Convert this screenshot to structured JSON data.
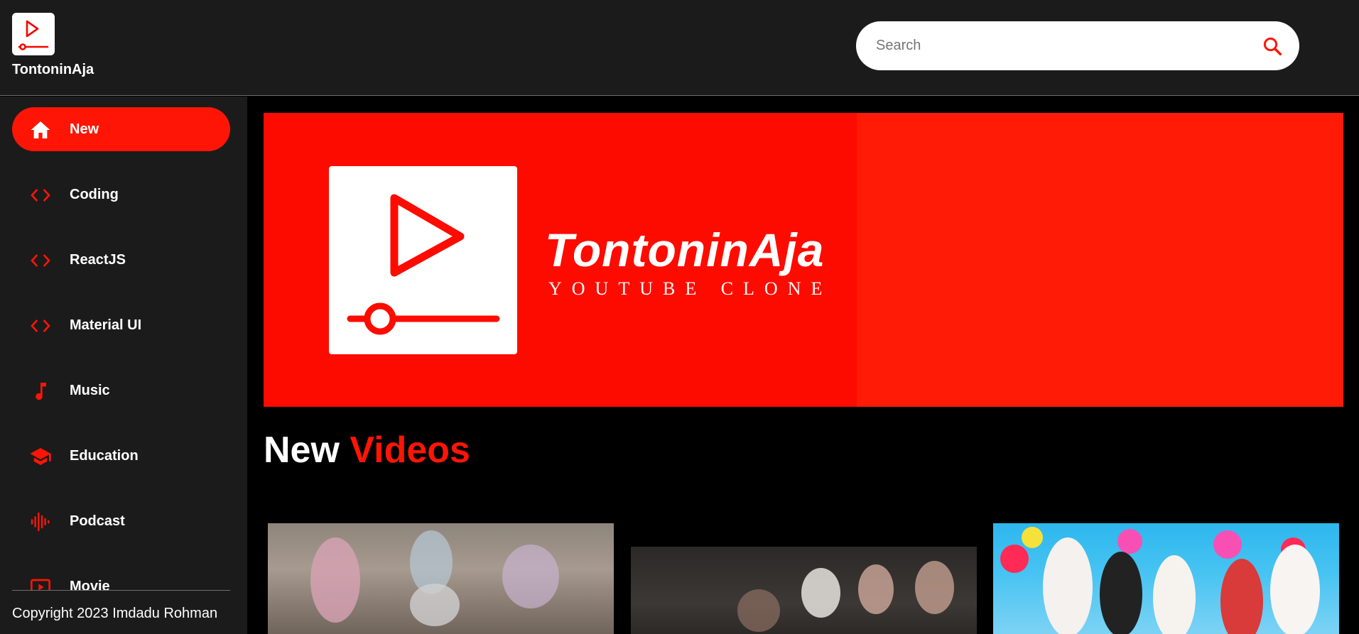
{
  "header": {
    "brand": "TontoninAja",
    "search_placeholder": "Search",
    "icons": {
      "logo": "play-logo-icon",
      "search": "search-icon"
    }
  },
  "sidebar": {
    "items": [
      {
        "label": "New",
        "icon": "home-icon",
        "active": true
      },
      {
        "label": "Coding",
        "icon": "code-icon",
        "active": false
      },
      {
        "label": "ReactJS",
        "icon": "code-icon",
        "active": false
      },
      {
        "label": "Material UI",
        "icon": "code-icon",
        "active": false
      },
      {
        "label": "Music",
        "icon": "music-note-icon",
        "active": false
      },
      {
        "label": "Education",
        "icon": "graduation-cap-icon",
        "active": false
      },
      {
        "label": "Podcast",
        "icon": "audio-wave-icon",
        "active": false
      },
      {
        "label": "Movie",
        "icon": "movie-icon",
        "active": false
      }
    ],
    "copyright": "Copyright 2023 Imdadu Rohman"
  },
  "banner": {
    "title": "TontoninAja",
    "subtitle": "YOUTUBE CLONE"
  },
  "section": {
    "title_main": "New",
    "title_accent": "Videos"
  },
  "colors": {
    "accent": "#ff1505",
    "banner": "#fe0b00",
    "header_bg": "#1b1b1b",
    "page_bg": "#000000"
  }
}
